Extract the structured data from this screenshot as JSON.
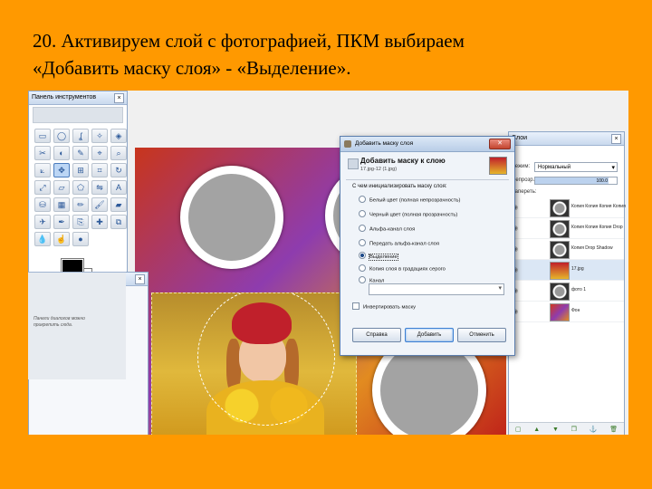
{
  "slide": {
    "line1": "20. Активируем слой с фотографией,  ПКМ выбираем",
    "line2": "«Добавить маску слоя» - «Выделение»."
  },
  "toolbox": {
    "title": "Панель инструментов",
    "hint": "Панели диалогов можно прикрепить сюда."
  },
  "dialog": {
    "title": "Добавить маску слоя",
    "heading": "Добавить маску к слою",
    "subheading": "17.jpg-12 (1.jpg)",
    "question": "С чем инициализировать маску слоя:",
    "options": [
      "Белый цвет (полная непрозрачность)",
      "Черный цвет (полная прозрачность)",
      "Альфа-канал слоя",
      "Передать альфа-канал слоя",
      "Выделение",
      "Копия слоя в градациях серого",
      "Канал"
    ],
    "selected_option": "Выделение",
    "invert_label": "Инвертировать маску",
    "buttons": {
      "help": "Справка",
      "add": "Добавить",
      "cancel": "Отменить"
    }
  },
  "layers_panel": {
    "title": "Слои",
    "mode_label": "Режим:",
    "mode_value": "Нормальный",
    "opacity_label": "Непрозр.:",
    "opacity_value": "100.0",
    "lock_label": "Запереть:",
    "layers": [
      "Копия Копия Копия Копия",
      "Копия Копия Копия Drop",
      "Копия Drop Shadow",
      "17.jpg",
      "фото 1",
      "Фон"
    ],
    "active_layer": "17.jpg"
  },
  "colors": {
    "slide_background": "#FF9900",
    "title_text": "#000000",
    "frame_gray": "#A3A3A3"
  }
}
